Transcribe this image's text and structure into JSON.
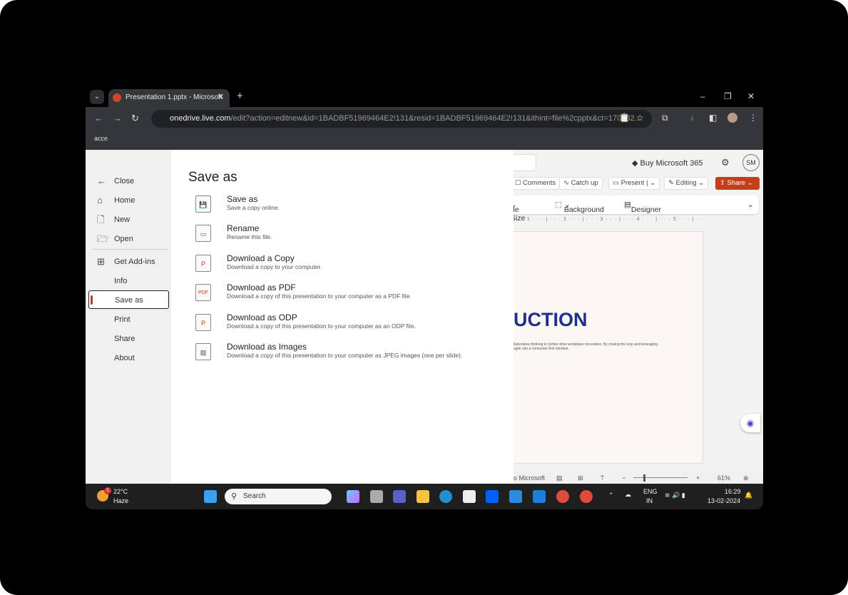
{
  "browser": {
    "tab_title": "Presentation 1.pptx - Microsoft",
    "url_domain": "onedrive.live.com",
    "url_path": "/edit?action=editnew&id=1BADBF51969464E2!131&resid=1BADBF51969464E2!131&ithint=file%2cpptx&ct=170782...",
    "bookmark": "acce"
  },
  "backstage": {
    "nav": [
      {
        "label": "Close",
        "icon": "←"
      },
      {
        "label": "Home",
        "icon": "⌂"
      },
      {
        "label": "New",
        "icon": "🗋"
      },
      {
        "label": "Open",
        "icon": "🗁"
      },
      {
        "label": "Get Add-ins",
        "icon": "⊞"
      },
      {
        "label": "Info"
      },
      {
        "label": "Save as"
      },
      {
        "label": "Print"
      },
      {
        "label": "Share"
      },
      {
        "label": "About"
      }
    ],
    "title": "Save as",
    "options": [
      {
        "title": "Save as",
        "desc": "Save a copy online.",
        "icon": "💾"
      },
      {
        "title": "Rename",
        "desc": "Rename this file.",
        "icon": "▭"
      },
      {
        "title": "Download a Copy",
        "desc": "Download a copy to your computer.",
        "icon": "P"
      },
      {
        "title": "Download as PDF",
        "desc": "Download a copy of this presentation to your computer as a PDF file.",
        "icon": "PDF"
      },
      {
        "title": "Download as ODP",
        "desc": "Download a copy of this presentation to your computer as an ODP file.",
        "icon": "P"
      },
      {
        "title": "Download as Images",
        "desc": "Download a copy of this presentation to your computer as JPEG images (one per slide).",
        "icon": "▨"
      }
    ]
  },
  "app": {
    "buy": "Buy Microsoft 365",
    "avatar": "SM",
    "comments": "Comments",
    "catchup": "Catch up",
    "present": "Present",
    "editing": "Editing",
    "share": "Share",
    "slide_size": "de Size",
    "background": "Background",
    "designer": "Designer",
    "ruler": "· · · 1 · · · | · · · 2 · · · | · · · 3 · · · | · · · 4 · · · | · · · 5 · · · | · · · 6 · · ·",
    "slide_title": "UCTION",
    "slide_text": "llaborative thinking to further drive workplace innovation. By closing the loop and leveraging agile ster a consumer-first mindset.",
    "status_left": "o Microsoft",
    "zoom": "61%"
  },
  "taskbar": {
    "temp": "22°C",
    "weather": "Haze",
    "badge": "1",
    "search": "Search",
    "lang1": "ENG",
    "lang2": "IN",
    "time": "16:29",
    "date": "13-02-2024"
  },
  "colors": {
    "accent": "#c43e1c",
    "title": "#1e2f8c"
  }
}
